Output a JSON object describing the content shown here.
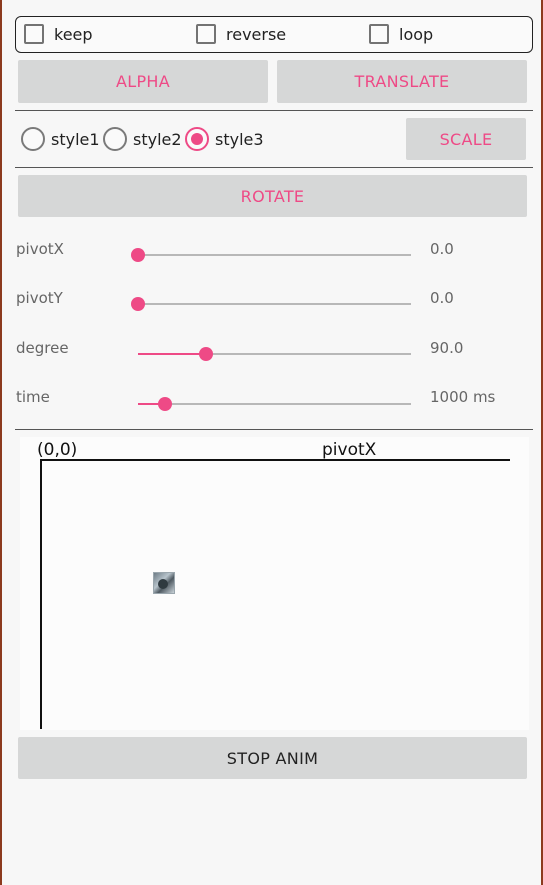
{
  "options": {
    "keep": {
      "label": "keep",
      "checked": false
    },
    "reverse": {
      "label": "reverse",
      "checked": false
    },
    "loop": {
      "label": "loop",
      "checked": false
    }
  },
  "buttons": {
    "alpha": "ALPHA",
    "translate": "TRANSLATE",
    "scale": "SCALE",
    "rotate": "ROTATE",
    "stop": "STOP ANIM"
  },
  "styles": {
    "items": [
      "style1",
      "style2",
      "style3"
    ],
    "selected": "style3"
  },
  "sliders": {
    "pivotX": {
      "label": "pivotX",
      "value": "0.0",
      "fraction": 0.0
    },
    "pivotY": {
      "label": "pivotY",
      "value": "0.0",
      "fraction": 0.0
    },
    "degree": {
      "label": "degree",
      "value": "90.0",
      "fraction": 0.25
    },
    "time": {
      "label": "time",
      "value": "1000 ms",
      "fraction": 0.1
    }
  },
  "stage": {
    "origin_label": "(0,0)",
    "x_axis_label": "pivotX"
  },
  "colors": {
    "accent": "#ee4a86",
    "button_bg": "#d6d7d7",
    "background": "#f7f7f7"
  }
}
